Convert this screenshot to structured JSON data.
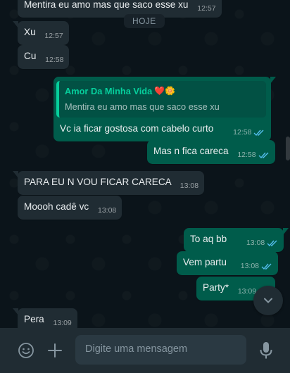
{
  "chat": {
    "day_divider": "HOJE",
    "messages": [
      {
        "dir": "in",
        "text": "Mentira eu amo mas que saco esse xu",
        "time": "12:57"
      },
      {
        "dir": "in",
        "text": "Xu",
        "time": "12:57"
      },
      {
        "dir": "in",
        "text": "Cu",
        "time": "12:58"
      },
      {
        "dir": "out",
        "quote_author": "Amor Da Minha Vida",
        "quote_emojis": "❤️🌼",
        "quote_text": "Mentira eu amo mas que saco esse xu",
        "text": "Vc ia ficar gostosa com cabelo curto",
        "time": "12:58",
        "status": "read"
      },
      {
        "dir": "out",
        "text": "Mas n fica careca",
        "time": "12:58",
        "status": "read"
      },
      {
        "dir": "in",
        "text": "PARA EU N VOU FICAR CARECA",
        "time": "13:08"
      },
      {
        "dir": "in",
        "text": "Moooh cadê vc",
        "time": "13:08"
      },
      {
        "dir": "out",
        "text": "To aq bb",
        "time": "13:08",
        "status": "read"
      },
      {
        "dir": "out",
        "text": "Vem partu",
        "time": "13:08",
        "status": "read"
      },
      {
        "dir": "out",
        "text": "Party*",
        "time": "13:09",
        "status": "read"
      },
      {
        "dir": "in",
        "text": "Pera",
        "time": "13:09"
      }
    ]
  },
  "composer": {
    "placeholder": "Digite uma mensagem",
    "emoji_icon": "emoji-icon",
    "attach_icon": "plus-icon",
    "mic_icon": "mic-icon"
  },
  "colors": {
    "background": "#0b141a",
    "incoming_bubble": "#202c33",
    "outgoing_bubble": "#005c4b",
    "read_ticks": "#53bdeb",
    "quote_accent": "#06cf9c"
  }
}
